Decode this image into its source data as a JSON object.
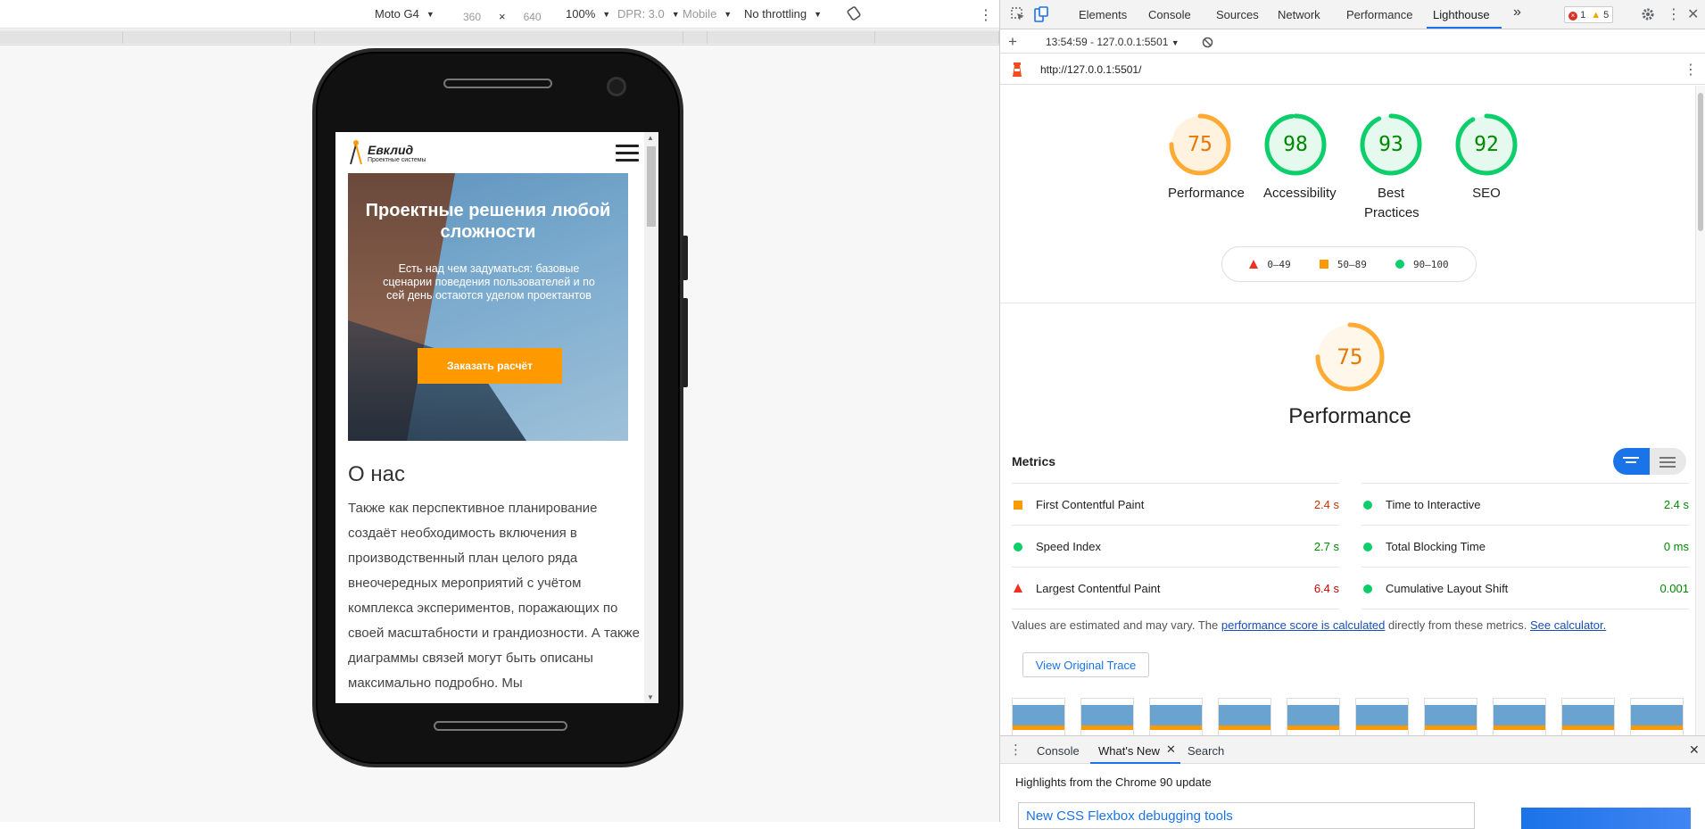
{
  "device_toolbar": {
    "device": "Moto G4",
    "width": "360",
    "times": "×",
    "height": "640",
    "zoom": "100%",
    "dpr": "DPR: 3.0",
    "mode": "Mobile",
    "throttling": "No throttling"
  },
  "site": {
    "logo_name": "Евклид",
    "logo_sub": "Проектные системы",
    "hero_title": "Проектные решения любой сложности",
    "hero_text": "Есть над чем задуматься: базовые сценарии поведения пользователей и по сей день остаются уделом проектантов",
    "hero_button": "Заказать расчёт",
    "about_title": "О нас",
    "about_text": "Также как перспективное планирование создаёт необходимость включения в производственный план целого ряда внеочередных мероприятий с учётом комплекса экспериментов, поражающих по своей масштабности и грандиозности. А также диаграммы связей могут быть описаны максимально подробно. Мы"
  },
  "devtools": {
    "tabs": [
      "Elements",
      "Console",
      "Sources",
      "Network",
      "Performance",
      "Lighthouse"
    ],
    "more": "»",
    "errors": "1",
    "warnings": "5",
    "report_select": "13:54:59 - 127.0.0.1:5501",
    "url": "http://127.0.0.1:5501/"
  },
  "scores": [
    {
      "label": "Performance",
      "value": 75,
      "color": "#fa3",
      "text": "#e67700",
      "fill": "#fff3e0"
    },
    {
      "label": "Accessibility",
      "value": 98,
      "color": "#0cce6b",
      "text": "#008800",
      "fill": "#e6f9ee"
    },
    {
      "label": "Best Practices",
      "value": 93,
      "color": "#0cce6b",
      "text": "#008800",
      "fill": "#e6f9ee"
    },
    {
      "label": "SEO",
      "value": 92,
      "color": "#0cce6b",
      "text": "#008800",
      "fill": "#e6f9ee"
    }
  ],
  "legend": {
    "fail": "0–49",
    "average": "50–89",
    "pass": "90–100"
  },
  "performance": {
    "score": "75",
    "title": "Performance",
    "metrics_title": "Metrics",
    "metrics_left": [
      {
        "name": "First Contentful Paint",
        "value": "2.4 s",
        "status": "average"
      },
      {
        "name": "Speed Index",
        "value": "2.7 s",
        "status": "pass"
      },
      {
        "name": "Largest Contentful Paint",
        "value": "6.4 s",
        "status": "fail"
      }
    ],
    "metrics_right": [
      {
        "name": "Time to Interactive",
        "value": "2.4 s",
        "status": "pass"
      },
      {
        "name": "Total Blocking Time",
        "value": "0 ms",
        "status": "pass"
      },
      {
        "name": "Cumulative Layout Shift",
        "value": "0.001",
        "status": "pass"
      }
    ],
    "note_pre": "Values are estimated and may vary. The",
    "note_link1": "performance score is calculated",
    "note_mid": "directly from these metrics.",
    "note_link2": "See calculator.",
    "trace_button": "View Original Trace"
  },
  "drawer": {
    "tabs": [
      "Console",
      "What's New",
      "Search"
    ],
    "highlights": "Highlights from the Chrome 90 update",
    "card_title": "New CSS Flexbox debugging tools"
  }
}
